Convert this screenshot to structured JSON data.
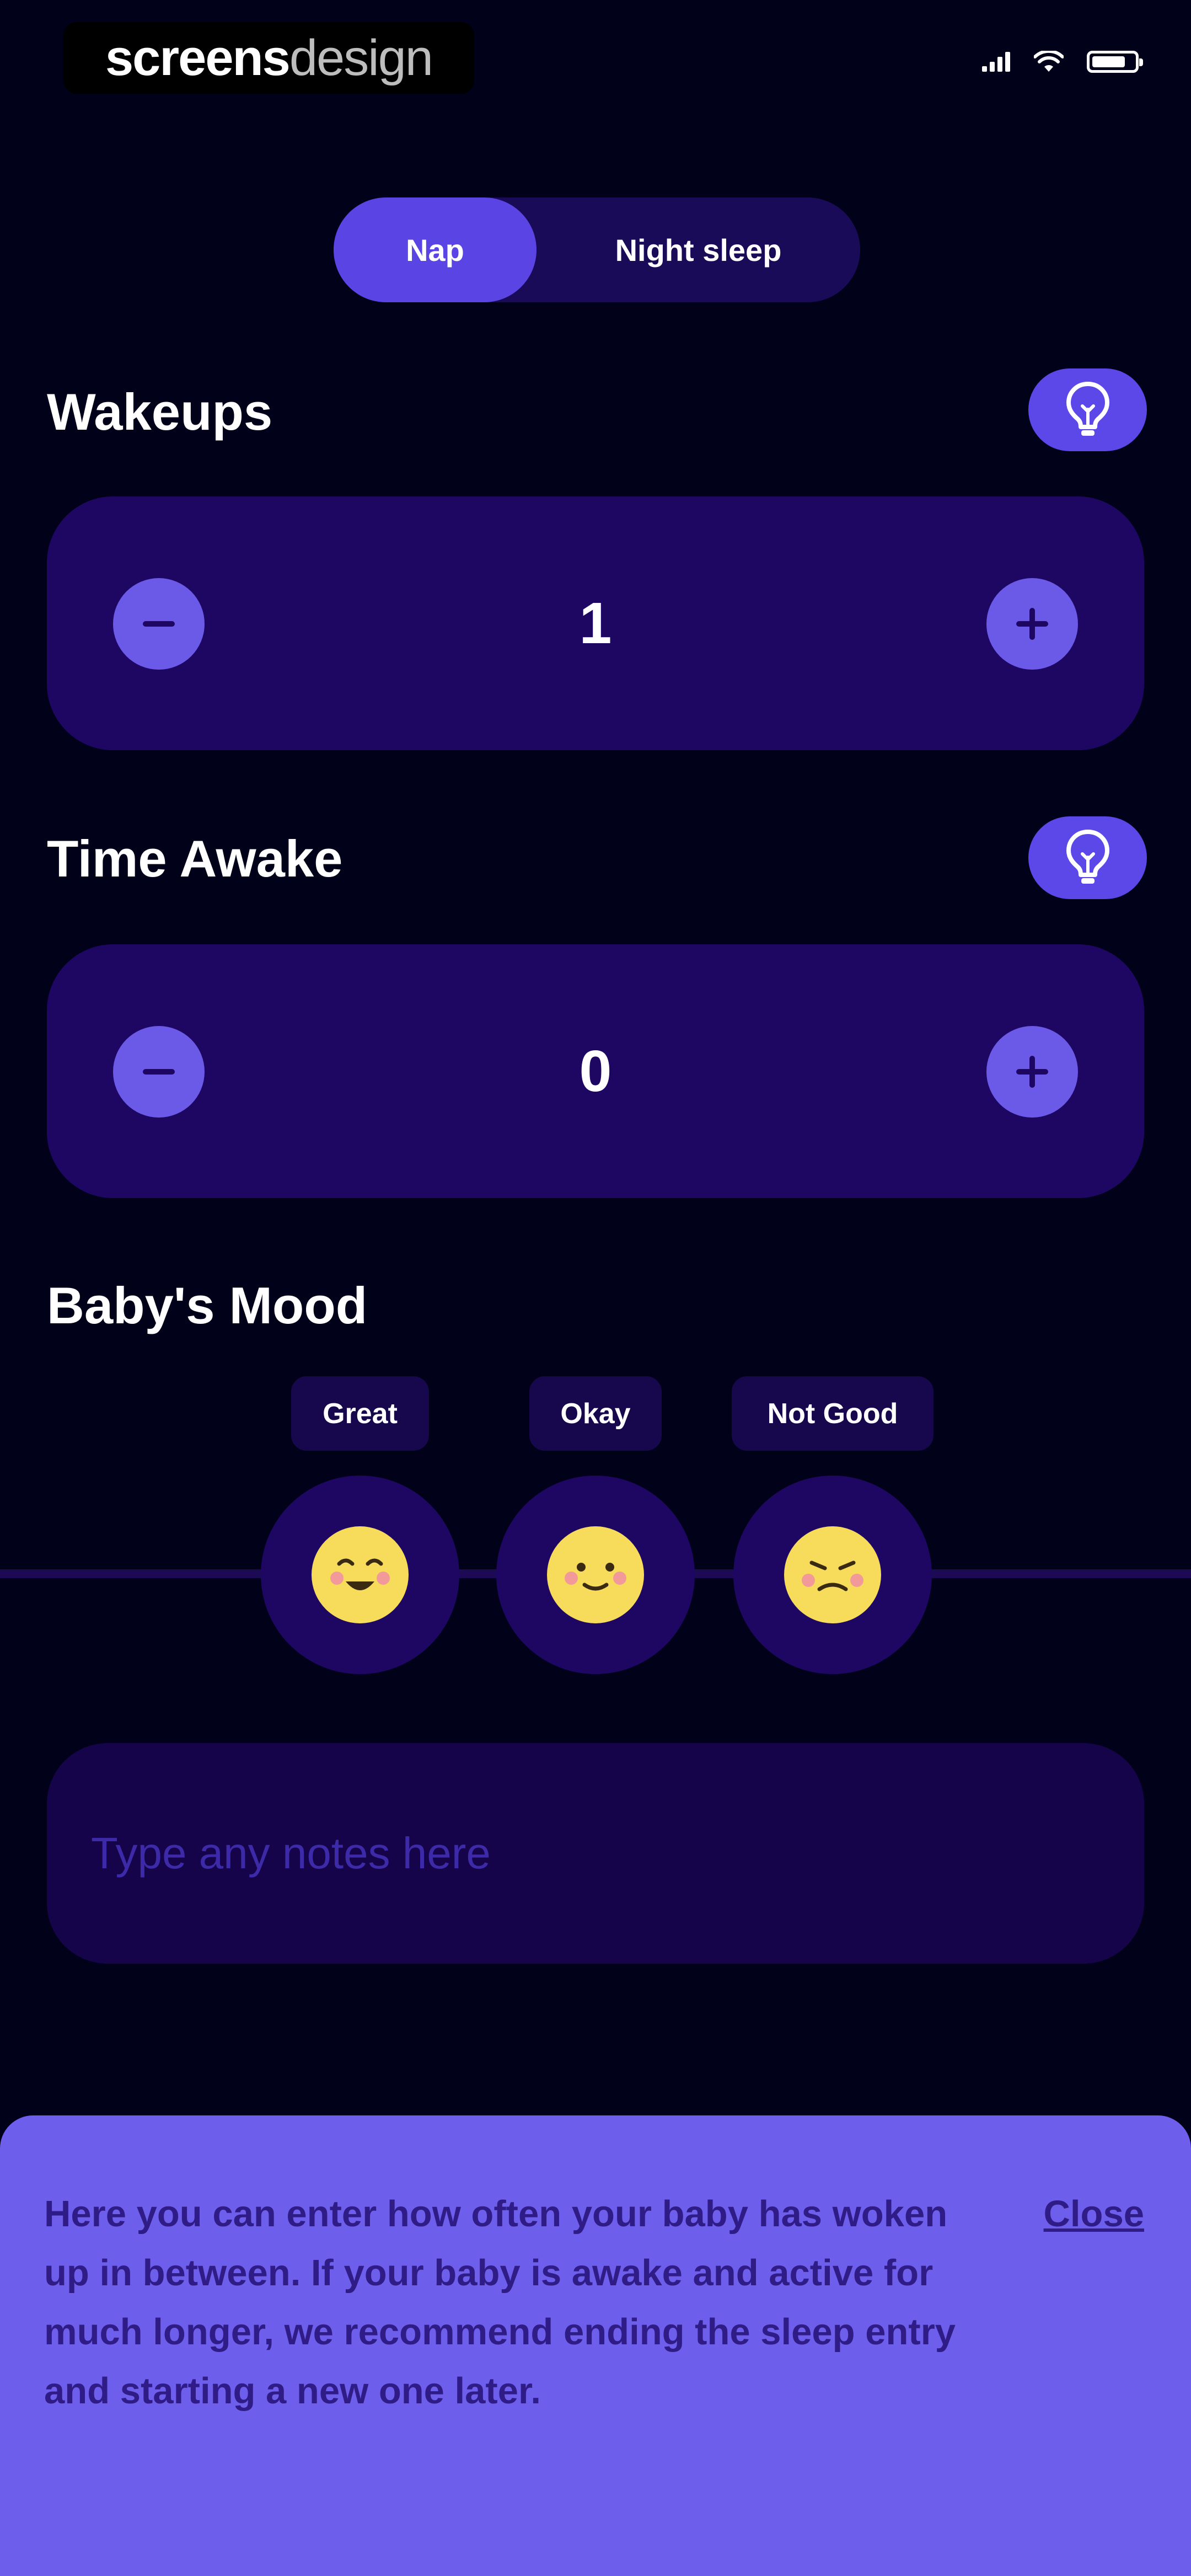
{
  "status_bar": {
    "brand_part1": "screens",
    "brand_part2": "design"
  },
  "segmented": {
    "options": [
      {
        "label": "Nap",
        "selected": true
      },
      {
        "label": "Night sleep",
        "selected": false
      }
    ]
  },
  "wakeups": {
    "title": "Wakeups",
    "value": "1"
  },
  "time_awake": {
    "title": "Time Awake",
    "value": "0"
  },
  "mood": {
    "title": "Baby's Mood",
    "options": [
      {
        "label": "Great",
        "icon": "happy-face-icon"
      },
      {
        "label": "Okay",
        "icon": "neutral-face-icon"
      },
      {
        "label": "Not Good",
        "icon": "sad-face-icon"
      }
    ]
  },
  "notes": {
    "placeholder": "Type any notes here"
  },
  "tip_panel": {
    "text": "Here you can enter how often your baby has woken up in between. If your baby is awake and active for much longer, we recommend ending the sleep entry and starting a new one later.",
    "close_label": "Close"
  },
  "colors": {
    "background": "#02011a",
    "accent": "#5b44e4",
    "card": "#1e0763",
    "tip_panel": "#6d5feb",
    "emoji_yellow": "#f7dc5c"
  }
}
